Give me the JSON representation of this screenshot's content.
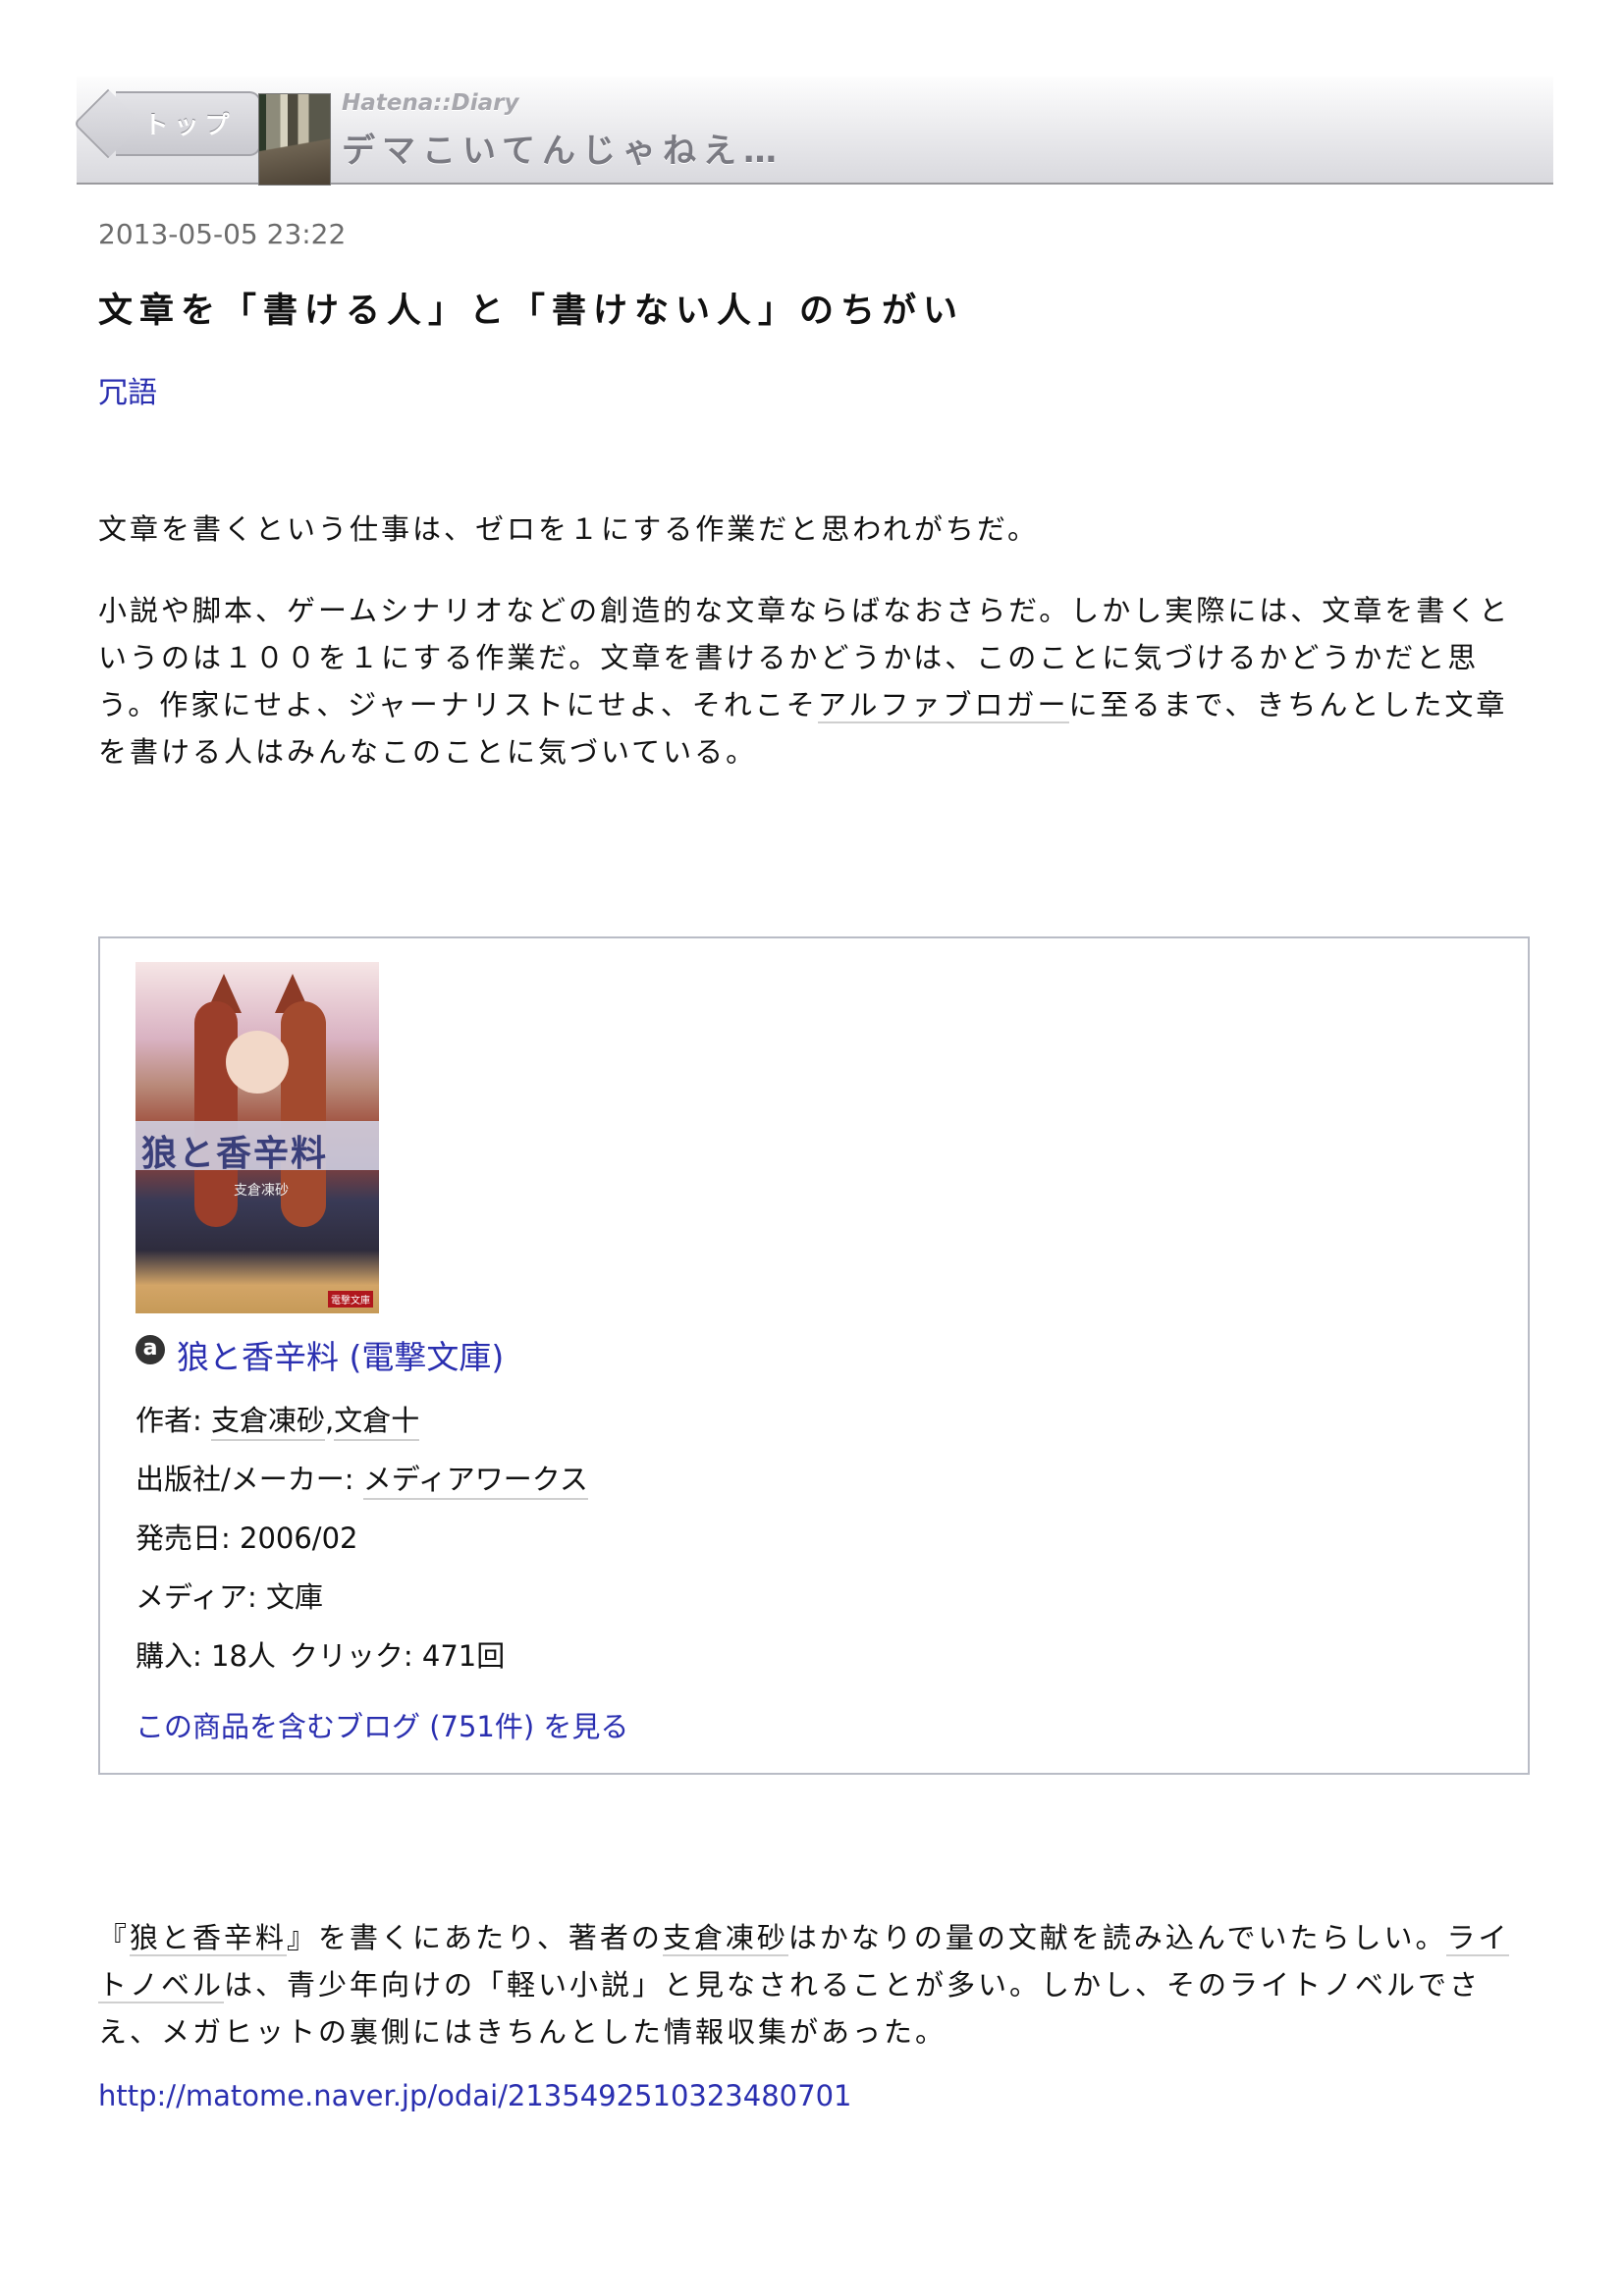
{
  "header": {
    "back_label": "トップ",
    "brand": "Hatena::Diary",
    "diary_title": "デマこいてんじゃねえ…"
  },
  "post": {
    "timestamp": "2013-05-05 23:22",
    "title": "文章を「書ける人」と「書けない人」のちがい",
    "category": "冗語",
    "para1": "文章を書くという仕事は、ゼロを１にする作業だと思われがちだ。",
    "para2_before": "小説や脚本、ゲームシナリオなどの創造的な文章ならばなおさらだ。しかし実際には、文章を書くというのは１００を１にする作業だ。文章を書けるかどうかは、このことに気づけるかどうかだと思う。作家にせよ、ジャーナリストにせよ、それこそ",
    "para2_keyword": "アルファブロガー",
    "para2_after": "に至るまで、きちんとした文章を書ける人はみんなこのことに気づいている。",
    "para3_open": "『",
    "para3_kw1": "狼と香辛料",
    "para3_mid1": "』を書くにあたり、著者の",
    "para3_kw2": "支倉凍砂",
    "para3_mid2": "はかなりの量の文献を読み込んでいたらしい。",
    "para3_kw3": "ライトノベル",
    "para3_after": "は、青少年向けの「軽い小説」と見なされることが多い。しかし、そのライトノベルでさえ、メガヒットの裏側にはきちんとした情報収集があった。",
    "url": "http://matome.naver.jp/odai/2135492510323480701"
  },
  "product": {
    "cover_title": "狼と香辛料",
    "cover_author": "支倉凍砂",
    "cover_label": "電撃文庫",
    "amazon_icon": "a",
    "title": "狼と香辛料 (電撃文庫)",
    "author_label": "作者: ",
    "author1": "支倉凍砂",
    "author_sep": ",",
    "author2": "文倉十",
    "publisher_label": "出版社/メーカー: ",
    "publisher": "メディアワークス",
    "release_label": "発売日: ",
    "release": "2006/02",
    "media_label": "メディア: ",
    "media": "文庫",
    "purchase_label": "購入: ",
    "purchase": "18人",
    "click_label": "クリック: ",
    "click": "471回",
    "blog_link": "この商品を含むブログ (751件) を見る"
  }
}
